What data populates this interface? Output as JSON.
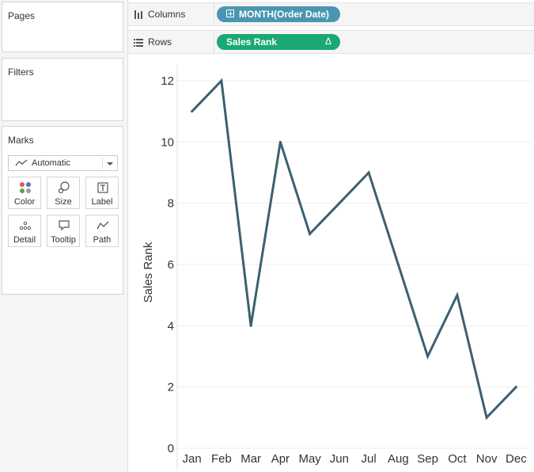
{
  "side": {
    "pages_title": "Pages",
    "filters_title": "Filters",
    "marks": {
      "title": "Marks",
      "mark_type": "Automatic",
      "buttons": [
        "Color",
        "Size",
        "Label",
        "Detail",
        "Tooltip",
        "Path"
      ]
    }
  },
  "shelves": {
    "columns": {
      "label": "Columns",
      "pill": "MONTH(Order Date)"
    },
    "rows": {
      "label": "Rows",
      "pill": "Sales Rank",
      "pill_symbol": "Δ"
    }
  },
  "colors": {
    "line": "#3b6071",
    "columns_pill": "#4a96b2",
    "rows_pill": "#1aa874",
    "grid": "#eeeeee"
  },
  "chart_data": {
    "type": "line",
    "categories": [
      "Jan",
      "Feb",
      "Mar",
      "Apr",
      "May",
      "Jun",
      "Jul",
      "Aug",
      "Sep",
      "Oct",
      "Nov",
      "Dec"
    ],
    "values": [
      11,
      12,
      4,
      10,
      7,
      8,
      9,
      6,
      3,
      5,
      1,
      2
    ],
    "ylabel": "Sales Rank",
    "xlabel": "",
    "ylim": [
      0,
      12
    ],
    "yticks": [
      0,
      2,
      4,
      6,
      8,
      10,
      12
    ],
    "grid": true
  }
}
